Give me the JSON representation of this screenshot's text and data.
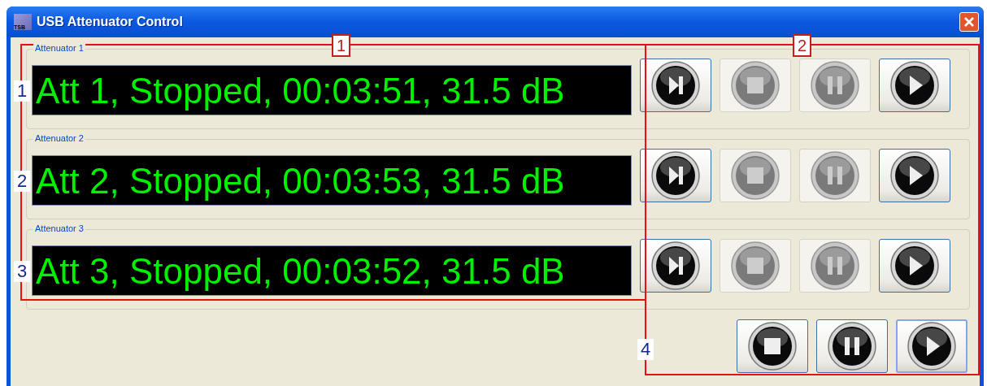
{
  "window": {
    "title": "USB Attenuator Control",
    "app_icon_text": "TSB"
  },
  "attenuators": [
    {
      "title": "Attenuator 1",
      "display": "Att 1, Stopped, 00:03:51, 31.5 dB",
      "marker": "1",
      "buttons": [
        {
          "kind": "skip",
          "disabled": false
        },
        {
          "kind": "stop",
          "disabled": true
        },
        {
          "kind": "pause",
          "disabled": true
        },
        {
          "kind": "play",
          "disabled": false
        }
      ]
    },
    {
      "title": "Attenuator 2",
      "display": "Att 2, Stopped, 00:03:53, 31.5 dB",
      "marker": "2",
      "buttons": [
        {
          "kind": "skip",
          "disabled": false
        },
        {
          "kind": "stop",
          "disabled": true
        },
        {
          "kind": "pause",
          "disabled": true
        },
        {
          "kind": "play",
          "disabled": false
        }
      ]
    },
    {
      "title": "Attenuator 3",
      "display": "Att 3, Stopped, 00:03:52, 31.5 dB",
      "marker": "3",
      "buttons": [
        {
          "kind": "skip",
          "disabled": false
        },
        {
          "kind": "stop",
          "disabled": true
        },
        {
          "kind": "pause",
          "disabled": true
        },
        {
          "kind": "play",
          "disabled": false
        }
      ]
    }
  ],
  "all_controls": {
    "marker": "4",
    "buttons": [
      {
        "kind": "stop",
        "disabled": false,
        "focused": false
      },
      {
        "kind": "pause",
        "disabled": false,
        "focused": false
      },
      {
        "kind": "play",
        "disabled": false,
        "focused": true
      }
    ]
  },
  "callouts": [
    "1",
    "2"
  ]
}
